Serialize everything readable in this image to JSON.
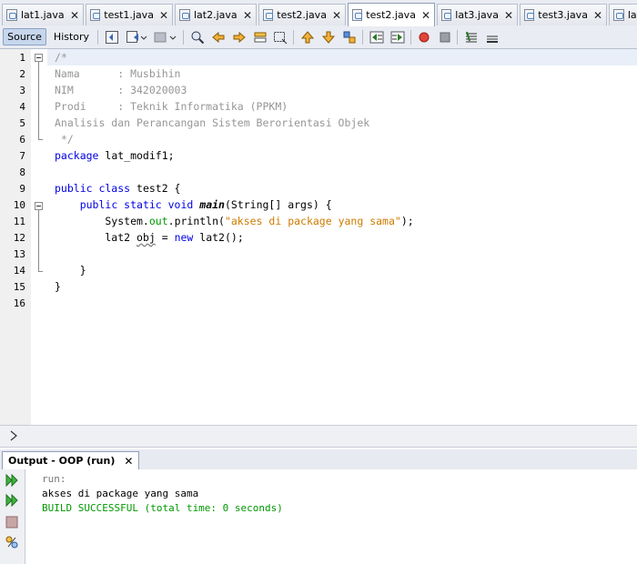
{
  "tabs": [
    {
      "label": "lat1.java",
      "active": false
    },
    {
      "label": "test1.java",
      "active": false
    },
    {
      "label": "lat2.java",
      "active": false
    },
    {
      "label": "test2.java",
      "active": false
    },
    {
      "label": "test2.java",
      "active": true
    },
    {
      "label": "lat3.java",
      "active": false
    },
    {
      "label": "test3.java",
      "active": false
    },
    {
      "label": "lat",
      "active": false
    }
  ],
  "close_glyph": "✕",
  "toolbar": {
    "source_label": "Source",
    "history_label": "History"
  },
  "editor": {
    "line_numbers": [
      "1",
      "2",
      "3",
      "4",
      "5",
      "6",
      "7",
      "8",
      "9",
      "10",
      "11",
      "12",
      "13",
      "14",
      "15",
      "16"
    ],
    "lines": {
      "l1": "/*",
      "l2": "Nama      : Musbihin",
      "l3": "NIM       : 342020003",
      "l4": "Prodi     : Teknik Informatika (PPKM)",
      "l5": "Analisis dan Perancangan Sistem Berorientasi Objek",
      "l6": " */",
      "l7_kw": "package",
      "l7_rest": " lat_modif1;",
      "l9_kw": "public class",
      "l9_rest": " test2 {",
      "l10_indent": "    ",
      "l10_kw": "public static void",
      "l10_sp": " ",
      "l10_method": "main",
      "l10_rest": "(String[] args) {",
      "l11_a": "        System.",
      "l11_field": "out",
      "l11_b": ".println(",
      "l11_str": "\"akses di package yang sama\"",
      "l11_c": ");",
      "l12_a": "        lat2 ",
      "l12_obj": "obj",
      "l12_b": " = ",
      "l12_kw": "new",
      "l12_c": " lat2();",
      "l14": "    }",
      "l15": "}"
    }
  },
  "output": {
    "tab_label": "Output - OOP (run)",
    "lines": {
      "run": "run:",
      "msg": "akses di package yang sama",
      "build": "BUILD SUCCESSFUL (total time: 0 seconds)"
    }
  },
  "icons": {
    "tab_file": "java-file-icon",
    "breadcrumb": "chevron-right-icon",
    "rerun": "rerun-icon",
    "rerun_alt": "rerun-with-options-icon",
    "stop": "stop-icon",
    "settings": "output-settings-icon"
  },
  "colors": {
    "keyword": "#0000e6",
    "string": "#ce7b00",
    "comment": "#969696",
    "field": "#009900",
    "build_success": "#009900",
    "output_text": "#000000",
    "run_text": "#777777"
  }
}
